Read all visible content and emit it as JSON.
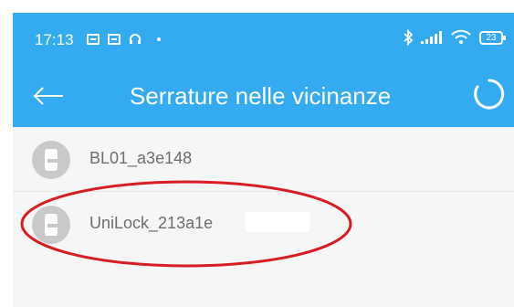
{
  "status_bar": {
    "time": "17:13",
    "battery": "23",
    "icons_left": [
      "photo-icon",
      "photo-icon",
      "headset-icon",
      "dot-icon"
    ],
    "icons_right": [
      "bluetooth-icon",
      "signal-icon",
      "wifi-icon",
      "battery-icon"
    ]
  },
  "toolbar": {
    "title": "Serrature nelle vicinanze",
    "back_icon": "back-arrow-icon",
    "spinner_icon": "loading-spinner-icon"
  },
  "devices": [
    {
      "name": "BL01_a3e148",
      "icon": "lock-icon"
    },
    {
      "name": "UniLock_213a1e",
      "icon": "lock-icon"
    }
  ],
  "colors": {
    "appbar": "#34abf0",
    "list_background": "#f6f6f6",
    "annotation": "#d81e25"
  }
}
